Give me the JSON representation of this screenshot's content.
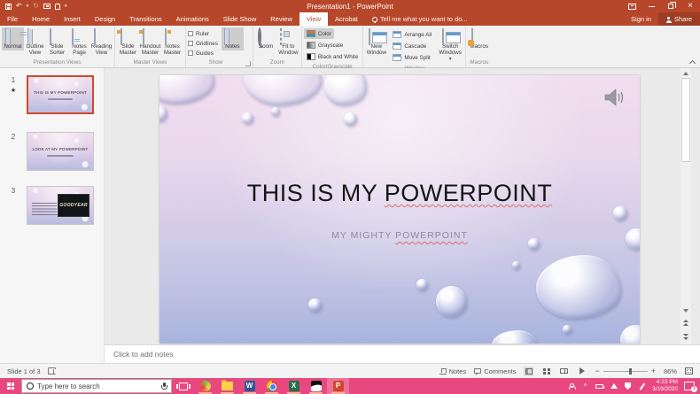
{
  "app": {
    "title": "Presentation1 - PowerPoint"
  },
  "titlebar": {
    "signin": "Sign in",
    "share": "Share"
  },
  "tabs": [
    {
      "label": "File"
    },
    {
      "label": "Home"
    },
    {
      "label": "Insert"
    },
    {
      "label": "Design"
    },
    {
      "label": "Transitions"
    },
    {
      "label": "Animations"
    },
    {
      "label": "Slide Show"
    },
    {
      "label": "Review"
    },
    {
      "label": "View"
    },
    {
      "label": "Acrobat"
    }
  ],
  "tellme": "Tell me what you want to do...",
  "ribbon": {
    "presentation_views": {
      "label": "Presentation Views",
      "normal": "Normal",
      "outline": "Outline\nView",
      "sorter": "Slide\nSorter",
      "notes_page": "Notes\nPage",
      "reading": "Reading\nView"
    },
    "master_views": {
      "label": "Master Views",
      "slide_master": "Slide\nMaster",
      "handout_master": "Handout\nMaster",
      "notes_master": "Notes\nMaster"
    },
    "show": {
      "label": "Show",
      "ruler": "Ruler",
      "gridlines": "Gridlines",
      "guides": "Guides",
      "notes": "Notes"
    },
    "zoom": {
      "label": "Zoom",
      "zoom": "Zoom",
      "fit": "Fit to\nWindow"
    },
    "color_grayscale": {
      "label": "Color/Grayscale",
      "color": "Color",
      "grayscale": "Grayscale",
      "bw": "Black and White"
    },
    "window": {
      "label": "Window",
      "new_window": "New\nWindow",
      "arrange": "Arrange All",
      "cascade": "Cascade",
      "move_split": "Move Split",
      "switch": "Switch\nWindows"
    },
    "macros": {
      "label": "Macros",
      "macros": "Macros"
    }
  },
  "icons": {
    "undo": "↶",
    "redo": "↻",
    "caret_down": "▾",
    "star": "★",
    "chevron_up": "^",
    "minus": "−",
    "plus": "+"
  },
  "thumbnails": [
    {
      "number": "1",
      "title": "THIS IS MY POWERPOINT"
    },
    {
      "number": "2",
      "title": "LOOK AT MY POWERPOINT"
    },
    {
      "number": "3",
      "image_text": "GOODYEAR"
    }
  ],
  "slide": {
    "title_prefix": "THIS IS MY ",
    "title_word": "POWERPOINT",
    "subtitle_prefix": "MY MIGHTY ",
    "subtitle_word": "POWERPOINT"
  },
  "notes_panel": {
    "placeholder": "Click to add notes"
  },
  "statusbar": {
    "slide_indicator": "Slide 1 of 3",
    "notes": "Notes",
    "comments": "Comments",
    "zoom": "86%"
  },
  "taskbar": {
    "search_placeholder": "Type here to search",
    "time": "4:23 PM",
    "date": "3/19/2020",
    "badge": "1"
  },
  "colors": {
    "brand": "#B7472A",
    "taskbar_accent": "#E8487F",
    "thumb_selection": "#D0492B",
    "squiggle": "#E06A6A"
  }
}
